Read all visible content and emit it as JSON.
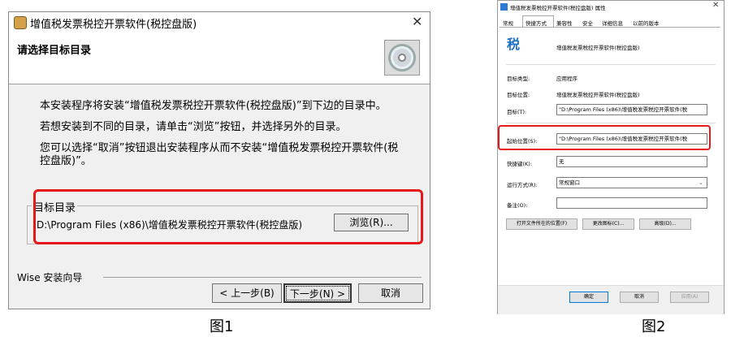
{
  "figure1": {
    "title": "增值税发票税控开票软件(税控盘版)",
    "header_title": "请选择目标目录",
    "paragraphs": [
      "本安装程序将安装“增值税发票税控开票软件(税控盘版)”到下边的目录中。",
      "若想安装到不同的目录，请单击“浏览”按钮，并选择另外的目录。",
      "您可以选择“取消”按钮退出安装程序从而不安装“增值税发票税控开票软件(税",
      "控盘版)”。"
    ],
    "group_label": "目标目录",
    "path": "D:\\Program Files (x86)\\增值税发票税控开票软件(税控盘版)",
    "browse_label": "浏览(R)...",
    "wizard_label": "Wise 安装向导",
    "back_label": "< 上一步(B)",
    "next_label": "下一步(N) >",
    "cancel_label": "取消",
    "caption": "图1"
  },
  "figure2": {
    "title": "增值税发票税控开票软件(税控盘版) 属性",
    "tabs": [
      "常规",
      "快捷方式",
      "兼容性",
      "安全",
      "详细信息",
      "以前的版本"
    ],
    "active_tab": "快捷方式",
    "app_name": "增值税发票税控开票软件(税控盘版)",
    "labels": {
      "target_type": "目标类型:",
      "target_location": "目标位置:",
      "target": "目标(T):",
      "start_in": "起始位置(S):",
      "shortcut_key": "快捷键(K):",
      "run": "运行方式(R):",
      "comment": "备注(O):"
    },
    "values": {
      "target_type": "应用程序",
      "target_location": "增值税发票税控开票软件(税控盘版)",
      "target": "\"D:\\Program Files (x86)\\增值税发票税控开票软件(税",
      "start_in": "\"D:\\Program Files (x86)\\增值税发票税控开票软件(税",
      "shortcut_key": "无",
      "run": "常规窗口",
      "comment": ""
    },
    "buttons": {
      "open_location": "打开文件所在的位置(F)",
      "change_icon": "更改图标(C)...",
      "advanced": "高级(D)..."
    },
    "ok_label": "确定",
    "cancel_label": "取消",
    "apply_label": "应用(A)",
    "caption": "图2"
  },
  "colors": {
    "highlight": "#e81818",
    "dialog_bg": "#f0f0f0"
  }
}
